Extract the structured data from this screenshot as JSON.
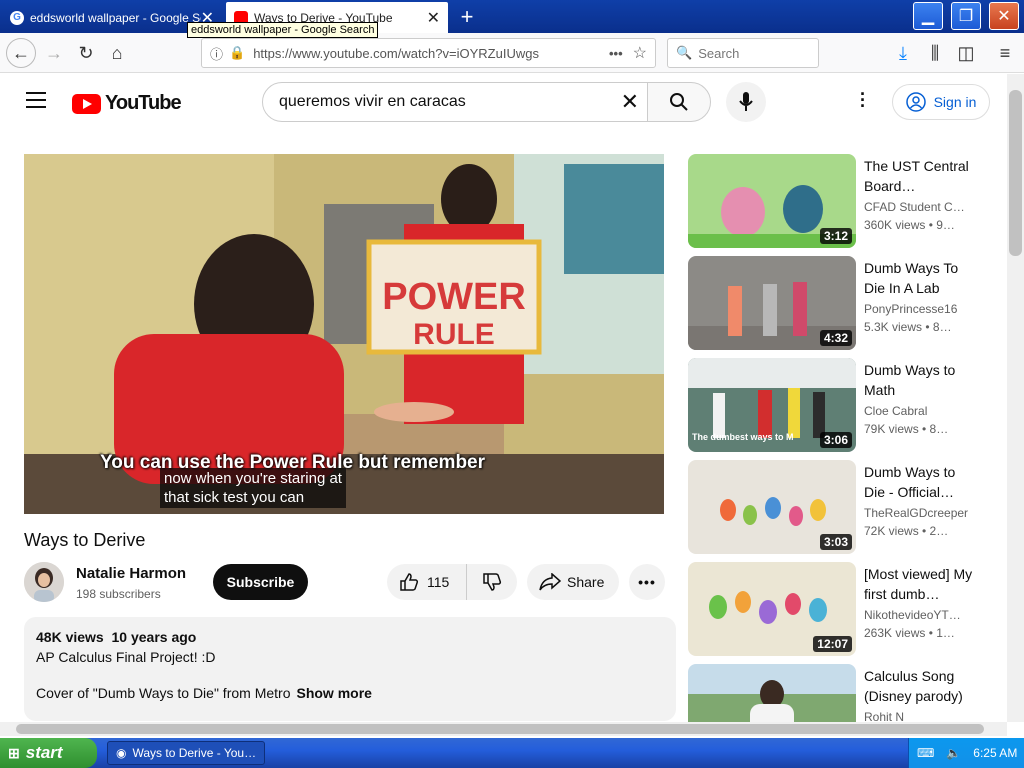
{
  "browser": {
    "tabs": [
      {
        "title": "eddsworld wallpaper - Google Search",
        "active": false
      },
      {
        "title": "Ways to Derive - YouTube",
        "active": true
      }
    ],
    "tooltip": "eddsworld wallpaper - Google Search",
    "url": "https://www.youtube.com/watch?v=iOYRZuIUwgs",
    "search_placeholder": "Search"
  },
  "youtube": {
    "logo_text": "YouTube",
    "search_query": "queremos vivir en caracas",
    "signin_label": "Sign in"
  },
  "video": {
    "caption_line1": "You can use the Power Rule but remember",
    "caption_line2a": "now when you're staring at",
    "caption_line2b": "that sick test you can",
    "sign_line1": "POWER",
    "sign_line2": "RULE",
    "title": "Ways to Derive",
    "channel_name": "Natalie Harmon",
    "subscribers": "198 subscribers",
    "subscribe_label": "Subscribe",
    "likes": "115",
    "share_label": "Share",
    "views": "48K views",
    "age": "10 years ago",
    "desc_line1": "AP Calculus Final Project! :D",
    "desc_line2": "Cover of \"Dumb Ways to Die\" from Metro",
    "show_more": "Show more"
  },
  "recommendations": [
    {
      "title": "The UST Central Board…",
      "channel": "CFAD Student C…",
      "meta": "360K views • 9…",
      "duration": "3:12",
      "thumb_color": "#a8d98a"
    },
    {
      "title": "Dumb Ways To Die In A Lab",
      "channel": "PonyPrincesse16",
      "meta": "5.3K views • 8…",
      "duration": "4:32",
      "thumb_color": "#8c8a86"
    },
    {
      "title": "Dumb Ways to Math",
      "channel": "Cloe Cabral",
      "meta": "79K views • 8…",
      "duration": "3:06",
      "thumb_color": "#5f7f74",
      "thumb_text": "The dumbest ways to M"
    },
    {
      "title": "Dumb Ways to Die - Official…",
      "channel": "TheRealGDcreeper",
      "meta": "72K views • 2…",
      "duration": "3:03",
      "thumb_color": "#e8e4dc"
    },
    {
      "title": "[Most viewed] My first dumb…",
      "channel": "NikothevideoYT…",
      "meta": "263K views • 1…",
      "duration": "12:07",
      "thumb_color": "#ebe6d4"
    },
    {
      "title": "Calculus Song (Disney parody)",
      "channel": "Rohit N",
      "meta": "",
      "duration": "",
      "thumb_color": "#7fa870"
    }
  ],
  "taskbar": {
    "start_label": "start",
    "window_label": "Ways to Derive - You…",
    "clock": "6:25 AM"
  }
}
